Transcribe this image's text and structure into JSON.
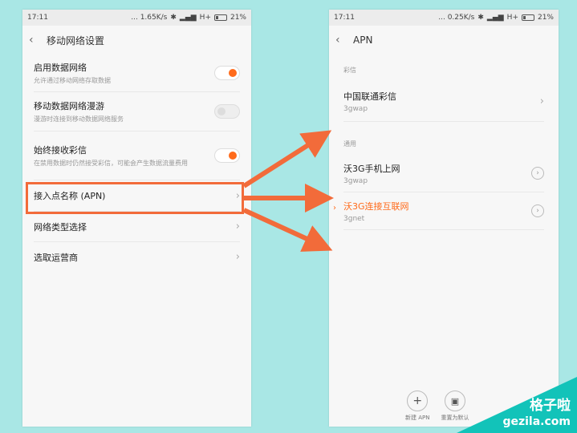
{
  "left_phone": {
    "status": {
      "time": "17:11",
      "speed": "... 1.65K/s",
      "network": "H+",
      "battery": "21%"
    },
    "title": "移动网络设置",
    "items": [
      {
        "title": "启用数据网络",
        "subtitle": "允许通过移动网络存取数据",
        "toggle": "on"
      },
      {
        "title": "移动数据网络漫游",
        "subtitle": "漫游时连接到移动数据网络服务",
        "toggle": "off"
      },
      {
        "title": "始终接收彩信",
        "subtitle": "在禁用数据时仍然接受彩信，可能会产生数据流量费用",
        "toggle": "on"
      },
      {
        "title": "接入点名称 (APN)"
      },
      {
        "title": "网络类型选择"
      },
      {
        "title": "选取运营商"
      }
    ]
  },
  "right_phone": {
    "status": {
      "time": "17:11",
      "speed": "... 0.25K/s",
      "network": "H+",
      "battery": "21%"
    },
    "title": "APN",
    "sections": [
      {
        "label": "彩信",
        "items": [
          {
            "name": "中国联通彩信",
            "apn": "3gwap"
          }
        ]
      },
      {
        "label": "通用",
        "items": [
          {
            "name": "沃3G手机上网",
            "apn": "3gwap",
            "active": false
          },
          {
            "name": "沃3G连接互联网",
            "apn": "3gnet",
            "active": true
          }
        ]
      }
    ],
    "actions": [
      {
        "label": "新建 APN",
        "icon": "plus-icon"
      },
      {
        "label": "重置为默认",
        "icon": "reset-icon"
      }
    ]
  },
  "watermark": {
    "line1": "格子啦",
    "line2": "gezila.com"
  },
  "colors": {
    "accent": "#ff6a1a",
    "annotation": "#f26b3a",
    "background": "#a9e7e5",
    "watermark": "#12c3b9"
  }
}
